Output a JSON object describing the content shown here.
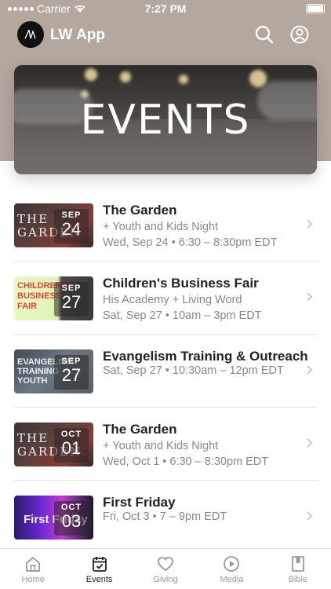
{
  "status_bar": {
    "carrier": "Carrier",
    "time": "7:27 PM"
  },
  "app": {
    "title": "LW App",
    "logo_text": "LW"
  },
  "hero": {
    "title": "EVENTS"
  },
  "events": [
    {
      "title": "The Garden",
      "subtitle": "+ Youth and Kids Night",
      "time": "Wed, Sep 24 • 6:30 – 8:30pm EDT",
      "month": "SEP",
      "day": "24",
      "thumb_text": "THE GARDEN"
    },
    {
      "title": "Children's Business Fair",
      "subtitle": "His Academy + Living Word",
      "time": "Sat, Sep 27 • 10am – 3pm EDT",
      "month": "SEP",
      "day": "27",
      "thumb_text": "CHILDREN'S BUSINESS FAIR"
    },
    {
      "title": "Evangelism Training & Outreach",
      "subtitle": "",
      "time": "Sat, Sep 27 • 10:30am – 12pm EDT",
      "month": "SEP",
      "day": "27",
      "thumb_text": "EVANGELISM TRAINING YOUTH"
    },
    {
      "title": "The Garden",
      "subtitle": "+ Youth and Kids Night",
      "time": "Wed, Oct 1 • 6:30 – 8:30pm EDT",
      "month": "OCT",
      "day": "01",
      "thumb_text": "THE GARDEN"
    },
    {
      "title": "First Friday",
      "subtitle": "",
      "time": "Fri, Oct 3 • 7 – 9pm EDT",
      "month": "OCT",
      "day": "03",
      "thumb_text": "First Friday"
    }
  ],
  "tabs": [
    {
      "label": "Home",
      "icon": "home-icon"
    },
    {
      "label": "Events",
      "icon": "calendar-icon",
      "active": true
    },
    {
      "label": "Giving",
      "icon": "heart-icon"
    },
    {
      "label": "Media",
      "icon": "play-icon"
    },
    {
      "label": "Bible",
      "icon": "book-icon"
    }
  ],
  "colors": {
    "header_bg": "#b3a79e",
    "active_tab": "#222222",
    "inactive_tab": "#999999"
  }
}
